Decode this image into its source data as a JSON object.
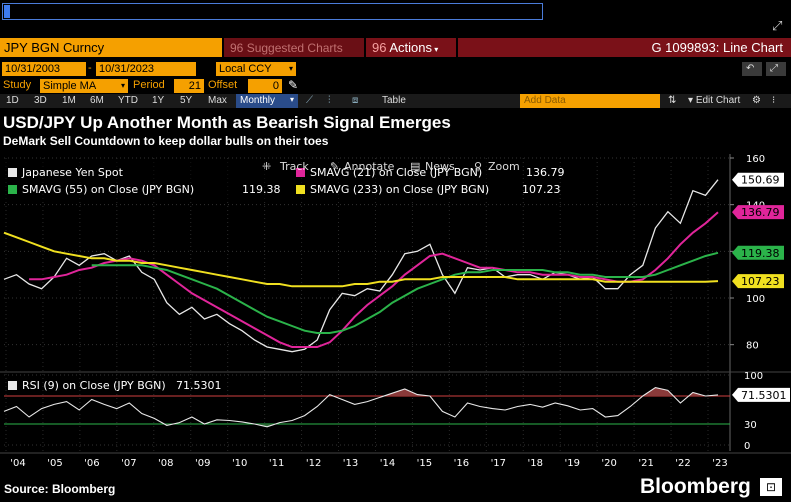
{
  "header": {
    "security": "JPY BGN Curncy",
    "suggested": "Suggested Charts",
    "actions": "Actions",
    "chart_id": "G 1099893: Line Chart"
  },
  "controls": {
    "start_date": "10/31/2003",
    "end_date": "10/31/2023",
    "currency": "Local CCY",
    "study_label": "Study",
    "study": "Simple MA",
    "period_label": "Period",
    "period": "21",
    "offset_label": "Offset",
    "offset": "0",
    "ranges": [
      "1D",
      "3D",
      "1M",
      "6M",
      "YTD",
      "1Y",
      "5Y",
      "Max"
    ],
    "frequency": "Monthly",
    "table": "Table",
    "add_data": "Add Data",
    "edit_chart": "Edit Chart"
  },
  "headline": {
    "title": "USD/JPY Up Another Month as Bearish Signal Emerges",
    "subtitle": "DeMark Sell Countdown to keep dollar bulls on their toes"
  },
  "overlay": {
    "track": "Track",
    "annotate": "Annotate",
    "news": "News",
    "zoom": "Zoom"
  },
  "colors": {
    "price": "#e8e8e8",
    "sma21": "#e0259a",
    "sma55": "#2bb34a",
    "sma233": "#f0e020",
    "rsi": "#e8e8e8",
    "rsi_over": "#d04040",
    "rsi_under": "#2bb34a",
    "accent": "#f5a000",
    "header_red": "#7a1118"
  },
  "chart_data": [
    {
      "type": "line",
      "x_labels": [
        "'04",
        "'05",
        "'06",
        "'07",
        "'08",
        "'09",
        "'10",
        "'11",
        "'12",
        "'13",
        "'14",
        "'15",
        "'16",
        "'17",
        "'18",
        "'19",
        "'20",
        "'21",
        "'22",
        "'23"
      ],
      "ylim": [
        70,
        160
      ],
      "yticks": [
        80,
        100,
        120,
        140,
        160
      ],
      "series": [
        {
          "name": "Japanese Yen Spot",
          "value_label": "150.69",
          "last": 150.69,
          "values": [
            108,
            110,
            106,
            104,
            109,
            117,
            114,
            118,
            119,
            116,
            118,
            111,
            108,
            98,
            93,
            96,
            91,
            93,
            89,
            86,
            82,
            79,
            78,
            77,
            78,
            82,
            95,
            102,
            101,
            104,
            103,
            110,
            119,
            120,
            123,
            110,
            102,
            113,
            112,
            113,
            109,
            110,
            110,
            108,
            111,
            110,
            108,
            109,
            104,
            104,
            110,
            114,
            130,
            137,
            132,
            146,
            144,
            150.69
          ]
        },
        {
          "name": "SMAVG (21) on Close (JPY BGN)",
          "value_label": "136.79",
          "last": 136.79,
          "values": [
            null,
            null,
            108,
            108,
            109,
            110,
            112,
            113,
            115,
            116,
            117,
            116,
            114,
            110,
            106,
            102,
            99,
            96,
            93,
            90,
            87,
            84,
            81,
            79,
            79,
            79,
            81,
            86,
            92,
            97,
            101,
            105,
            110,
            114,
            118,
            119,
            117,
            115,
            113,
            113,
            112,
            111,
            111,
            110,
            110,
            110,
            109,
            109,
            108,
            107,
            107,
            108,
            112,
            117,
            123,
            128,
            132,
            136.79
          ]
        },
        {
          "name": "SMAVG (55) on Close (JPY BGN)",
          "value_label": "119.38",
          "last": 119.38,
          "values": [
            null,
            null,
            null,
            null,
            null,
            null,
            null,
            114,
            114,
            114,
            114,
            114,
            113,
            112,
            110,
            108,
            106,
            104,
            101,
            98,
            95,
            92,
            90,
            88,
            86,
            85,
            85,
            86,
            88,
            91,
            94,
            98,
            101,
            104,
            106,
            108,
            110,
            111,
            111,
            112,
            112,
            112,
            112,
            112,
            111,
            111,
            110,
            110,
            109,
            109,
            109,
            109,
            110,
            112,
            114,
            116,
            118,
            119.38
          ]
        },
        {
          "name": "SMAVG (233) on Close (JPY BGN)",
          "value_label": "107.23",
          "last": 107.23,
          "values": [
            128,
            126,
            124,
            122,
            120,
            119,
            118,
            117,
            117,
            116,
            116,
            115,
            115,
            114,
            113,
            112,
            111,
            110,
            109,
            108,
            107,
            106,
            106,
            105,
            105,
            105,
            105,
            105,
            106,
            106,
            107,
            107,
            108,
            108,
            108,
            109,
            109,
            109,
            109,
            109,
            109,
            108,
            108,
            108,
            108,
            108,
            108,
            108,
            107,
            107,
            107,
            107,
            107,
            107,
            107,
            107,
            107,
            107.23
          ]
        }
      ]
    },
    {
      "type": "area",
      "ylim": [
        0,
        100
      ],
      "yticks": [
        0,
        30,
        70,
        100
      ],
      "series": [
        {
          "name": "RSI (9) on Close (JPY BGN)",
          "value_label": "71.5301",
          "last": 71.5301,
          "values": [
            48,
            55,
            40,
            52,
            58,
            62,
            50,
            65,
            58,
            52,
            60,
            45,
            38,
            28,
            32,
            40,
            30,
            36,
            35,
            33,
            30,
            26,
            32,
            35,
            42,
            55,
            72,
            65,
            58,
            62,
            68,
            74,
            80,
            72,
            70,
            48,
            40,
            60,
            55,
            52,
            50,
            55,
            58,
            54,
            60,
            56,
            50,
            52,
            40,
            42,
            55,
            70,
            82,
            78,
            60,
            75,
            70,
            71.5301
          ]
        }
      ]
    }
  ],
  "footer": {
    "source": "Source: Bloomberg",
    "brand": "Bloomberg"
  }
}
